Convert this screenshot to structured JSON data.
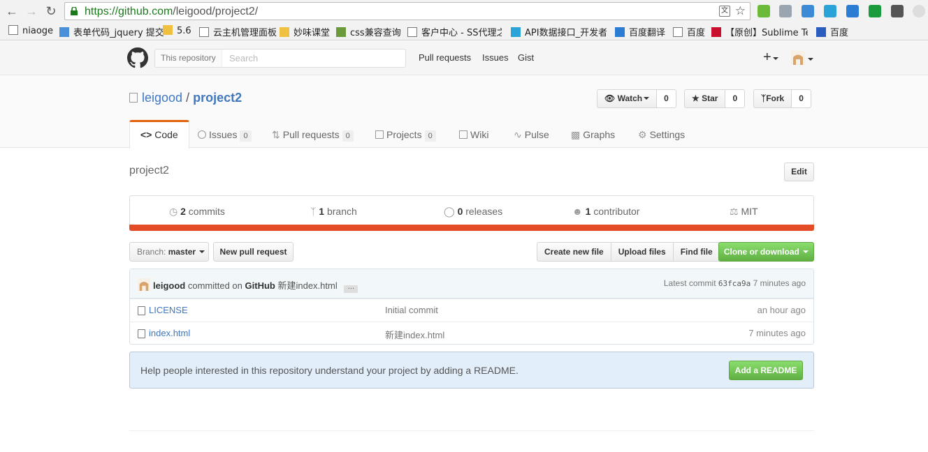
{
  "browser": {
    "url_host": "https://github.com",
    "url_path": "/leigood/project2/",
    "bookmarks": [
      {
        "label": "niaoge"
      },
      {
        "label": "表单代码_jquery 提交"
      },
      {
        "label": "5.6"
      },
      {
        "label": "云主机管理面板"
      },
      {
        "label": "妙味课堂"
      },
      {
        "label": "css兼容查询"
      },
      {
        "label": "客户中心 - SS代理之家"
      },
      {
        "label": "API数据接口_开发者数"
      },
      {
        "label": "百度翻译"
      },
      {
        "label": "百度"
      },
      {
        "label": "【原创】Sublime Te"
      },
      {
        "label": "百度"
      }
    ]
  },
  "header": {
    "search_scope": "This repository",
    "search_placeholder": "Search",
    "nav": [
      "Pull requests",
      "Issues",
      "Gist"
    ],
    "plus_label": "+"
  },
  "repo": {
    "owner": "leigood",
    "separator": "/",
    "name": "project2",
    "watch_label": "Watch",
    "watch_count": "0",
    "star_label": "Star",
    "star_count": "0",
    "fork_label": "Fork",
    "fork_count": "0",
    "tabs": [
      {
        "label": "Code",
        "count": null,
        "selected": true
      },
      {
        "label": "Issues",
        "count": "0"
      },
      {
        "label": "Pull requests",
        "count": "0"
      },
      {
        "label": "Projects",
        "count": "0"
      },
      {
        "label": "Wiki",
        "count": null
      },
      {
        "label": "Pulse",
        "count": null
      },
      {
        "label": "Graphs",
        "count": null
      },
      {
        "label": "Settings",
        "count": null
      }
    ]
  },
  "main": {
    "description": "project2",
    "edit_label": "Edit",
    "summary": {
      "commits_count": "2",
      "commits_label": "commits",
      "branch_count": "1",
      "branch_label": "branch",
      "releases_count": "0",
      "releases_label": "releases",
      "contributor_count": "1",
      "contributor_label": "contributor",
      "license": "MIT"
    },
    "language_color": "#e34c26",
    "branch_prefix": "Branch:",
    "branch_name": "master",
    "new_pr_label": "New pull request",
    "file_buttons": [
      "Create new file",
      "Upload files",
      "Find file"
    ],
    "clone_label": "Clone or download",
    "commit": {
      "author": "leigood",
      "committed_on": "committed on",
      "via": "GitHub",
      "message": "新建index.html",
      "ellipsis": "…",
      "latest_label": "Latest commit",
      "sha": "63fca9a",
      "age": "7 minutes ago"
    },
    "files": [
      {
        "name": "LICENSE",
        "message": "Initial commit",
        "age": "an hour ago"
      },
      {
        "name": "index.html",
        "message": "新建index.html",
        "age": "7 minutes ago"
      }
    ],
    "readme_prompt": "Help people interested in this repository understand your project by adding a README.",
    "readme_button": "Add a README"
  }
}
